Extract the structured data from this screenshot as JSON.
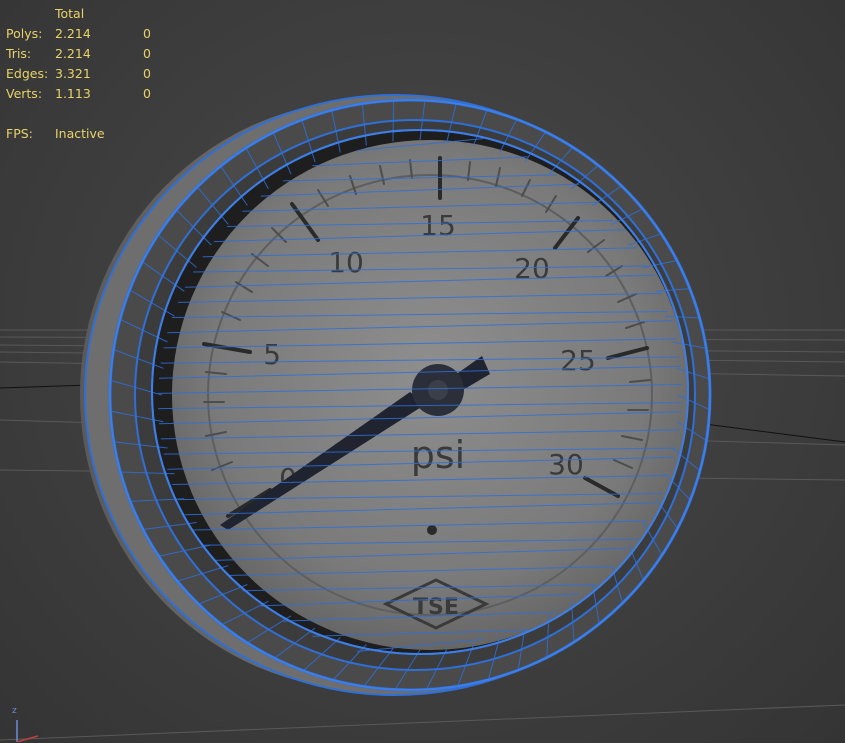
{
  "stats": {
    "header": "Total",
    "rows": [
      {
        "label": "Polys:",
        "total": "2.214",
        "selected": "0"
      },
      {
        "label": "Tris:",
        "total": "2.214",
        "selected": "0"
      },
      {
        "label": "Edges:",
        "total": "3.321",
        "selected": "0"
      },
      {
        "label": "Verts:",
        "total": "1.113",
        "selected": "0"
      }
    ],
    "fps_label": "FPS:",
    "fps_value": "Inactive"
  },
  "gauge": {
    "labels": [
      "0",
      "5",
      "10",
      "15",
      "20",
      "25",
      "30"
    ],
    "unit": "psi",
    "brand": "TSE"
  },
  "axis": {
    "z_label": "z"
  },
  "colors": {
    "stats_text": "#e8d36a",
    "wireframe": "#2f6fd8",
    "viewport_bg": "#3c3c3c"
  }
}
